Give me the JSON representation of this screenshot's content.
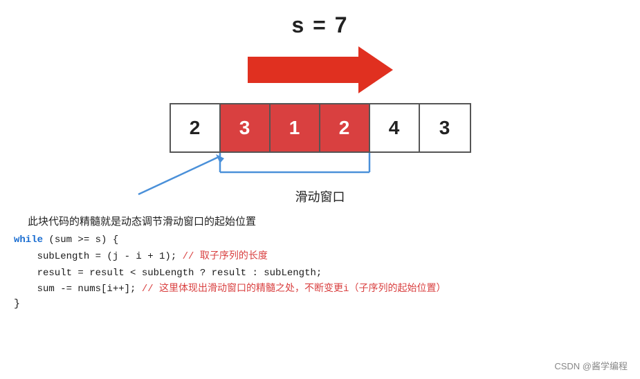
{
  "title": "s = 7",
  "array": {
    "cells": [
      {
        "value": "2",
        "highlighted": false
      },
      {
        "value": "3",
        "highlighted": true
      },
      {
        "value": "1",
        "highlighted": true
      },
      {
        "value": "2",
        "highlighted": true
      },
      {
        "value": "4",
        "highlighted": false
      },
      {
        "value": "3",
        "highlighted": false
      }
    ]
  },
  "sliding_window_label": "滑动窗口",
  "description": "此块代码的精髓就是动态调节滑动窗口的起始位置",
  "code": {
    "line1_keyword": "while",
    "line1_rest": " (sum >= s) {",
    "line2": "    subLength = (j - i + 1); ",
    "line2_comment": "// 取子序列的长度",
    "line3": "    result = result < subLength ? result : subLength;",
    "line4": "    sum -= nums[i++]; ",
    "line4_comment": "// 这里体现出滑动窗口的精髓之处，不断变更i（子序列的起始位置）",
    "line5": "}"
  },
  "watermark": "CSDN @酱学编程"
}
